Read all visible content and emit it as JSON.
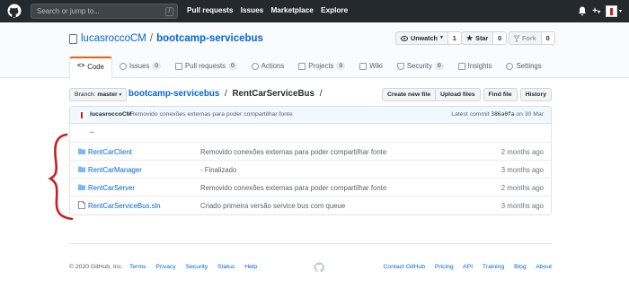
{
  "header": {
    "search_placeholder": "Search or jump to...",
    "search_key": "/",
    "nav": [
      "Pull requests",
      "Issues",
      "Marketplace",
      "Explore"
    ],
    "plus_label": "+",
    "caret": "▾"
  },
  "repo": {
    "owner": "lucasroccoCM",
    "separator": "/",
    "name": "bootcamp-servicebus",
    "watch_label": "Unwatch",
    "watch_count": "1",
    "star_label": "Star",
    "star_count": "0",
    "fork_label": "Fork",
    "fork_count": "0"
  },
  "tabs": [
    {
      "label": "Code",
      "icon": "<>",
      "count": ""
    },
    {
      "label": "Issues",
      "count": "0"
    },
    {
      "label": "Pull requests",
      "count": "0"
    },
    {
      "label": "Actions",
      "count": ""
    },
    {
      "label": "Projects",
      "count": "0"
    },
    {
      "label": "Wiki",
      "count": ""
    },
    {
      "label": "Security",
      "count": "0"
    },
    {
      "label": "Insights",
      "count": ""
    },
    {
      "label": "Settings",
      "count": ""
    }
  ],
  "filenav": {
    "branch_prefix": "Branch:",
    "branch": "master",
    "crumb_root": "bootcamp-servicebus",
    "crumb_sep": "/",
    "crumb_current": "RentCarServiceBus",
    "crumb_trail": "/",
    "buttons": [
      "Create new file",
      "Upload files",
      "Find file",
      "History"
    ]
  },
  "commit": {
    "author": "lucasroccoCM",
    "message": "Removido conexões externas para poder compartilhar fonte",
    "latest_label": "Latest commit",
    "sha": "386a0fa",
    "date": "on 30 Mar"
  },
  "files": {
    "parent": "..",
    "rows": [
      {
        "name": "RentCarClient",
        "type": "folder",
        "message": "Removido conexões externas para poder compartilhar fonte",
        "age": "2 months ago"
      },
      {
        "name": "RentCarManager",
        "type": "folder",
        "message": "- Finalizado",
        "age": "3 months ago"
      },
      {
        "name": "RentCarServer",
        "type": "folder",
        "message": "Removido conexões externas para poder compartilhar fonte",
        "age": "2 months ago"
      },
      {
        "name": "RentCarServiceBus.sln",
        "type": "file",
        "message": "Criado primeira versão service bus com queue",
        "age": "3 months ago"
      }
    ]
  },
  "footer": {
    "copyright": "© 2020 GitHub, Inc.",
    "left_links": [
      "Terms",
      "Privacy",
      "Security",
      "Status",
      "Help"
    ],
    "right_links": [
      "Contact GitHub",
      "Pricing",
      "API",
      "Training",
      "Blog",
      "About"
    ]
  },
  "colors": {
    "header_bg": "#24292e",
    "link": "#0366d6",
    "tab_accent": "#e36209",
    "folder": "#79b8ff",
    "annotation": "#c8201e"
  }
}
